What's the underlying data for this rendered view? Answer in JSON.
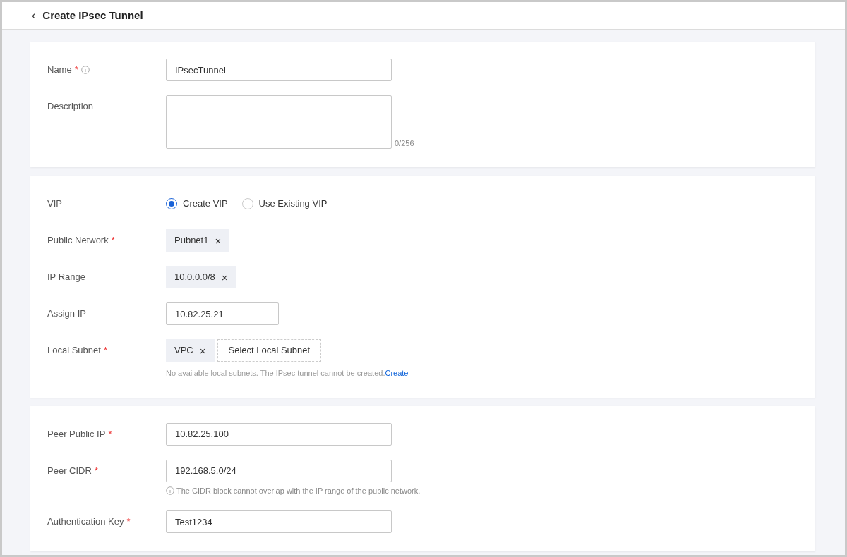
{
  "header": {
    "back": "‹",
    "title": "Create IPsec Tunnel"
  },
  "sections": [
    {
      "fields": [
        {
          "kind": "text",
          "label": "Name",
          "required_mark": "*",
          "info": true,
          "value": "IPsecTunnel"
        },
        {
          "kind": "textarea",
          "label": "Description",
          "counter": "0/256"
        }
      ]
    },
    {
      "fields": [
        {
          "kind": "radio",
          "label": "VIP",
          "options": [
            {
              "label": "Create VIP",
              "selected": true
            },
            {
              "label": "Use Existing VIP",
              "selected": false
            }
          ]
        },
        {
          "kind": "tags",
          "label": "Public Network",
          "required_mark": "*",
          "tags": [
            {
              "text": "Pubnet1",
              "remove": "×"
            }
          ]
        },
        {
          "kind": "tags",
          "label": "IP Range",
          "tags": [
            {
              "text": "10.0.0.0/8",
              "remove": "×"
            }
          ]
        },
        {
          "kind": "text",
          "label": "Assign IP",
          "value": "10.82.25.21",
          "short": true
        },
        {
          "kind": "tags",
          "label": "Local Subnet",
          "required_mark": "*",
          "tags": [
            {
              "text": "VPC",
              "remove": "×"
            }
          ],
          "select_button": "Select Local Subnet",
          "help": "No available local subnets. The IPsec tunnel cannot be created.",
          "help_link": "Create"
        }
      ]
    },
    {
      "fields": [
        {
          "kind": "text",
          "label": "Peer Public IP",
          "required_mark": "*",
          "value": "10.82.25.100"
        },
        {
          "kind": "text",
          "label": "Peer CIDR",
          "required_mark": "*",
          "value": "192.168.5.0/24",
          "hint": "The CIDR block cannot overlap with the IP range of the public network.",
          "hint_icon": true
        },
        {
          "kind": "text",
          "label": "Authentication Key",
          "required_mark": "*",
          "value": "Test1234"
        }
      ]
    }
  ]
}
